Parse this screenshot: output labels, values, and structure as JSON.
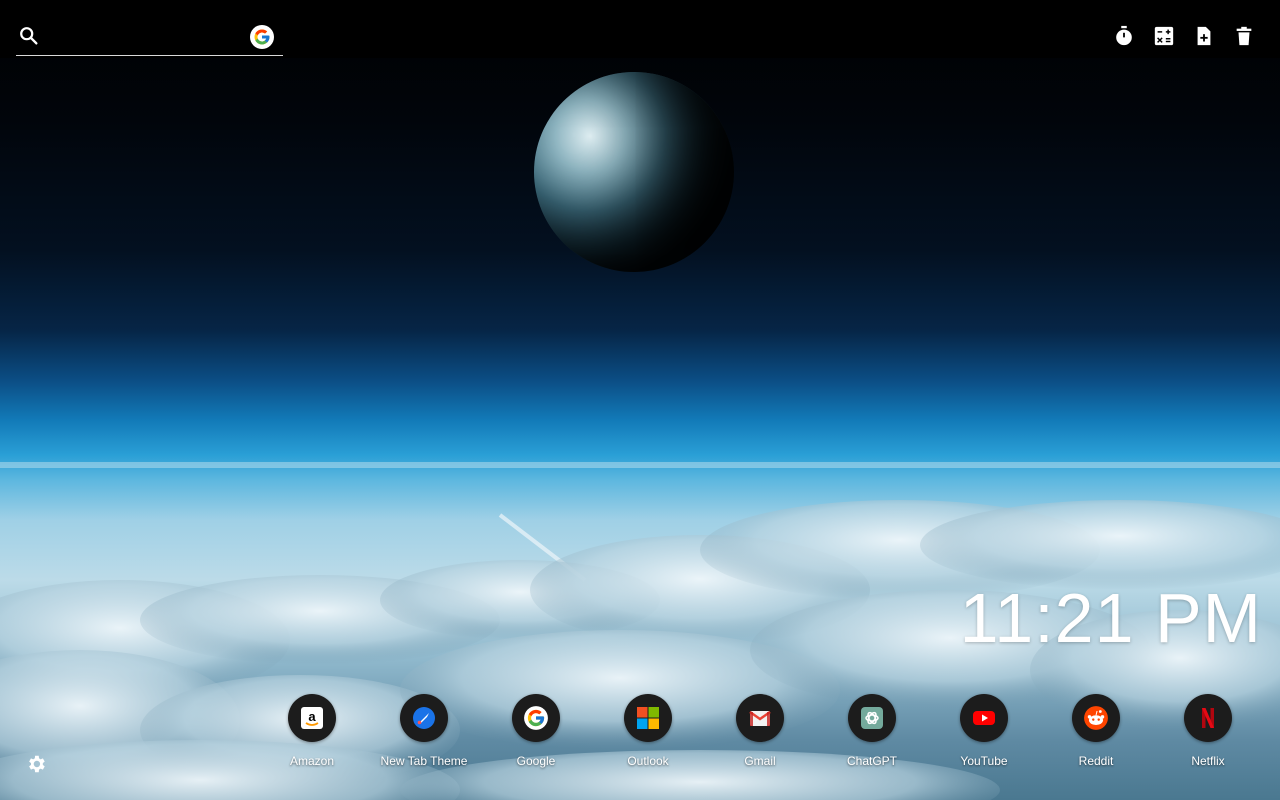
{
  "search": {
    "value": "",
    "placeholder": "",
    "engine_icon": "google-icon",
    "icon": "search-icon"
  },
  "toolbar": {
    "buttons": [
      {
        "name": "timer-button",
        "icon": "stopwatch-icon"
      },
      {
        "name": "calculator-button",
        "icon": "calculator-icon"
      },
      {
        "name": "new-note-button",
        "icon": "note-add-icon"
      },
      {
        "name": "delete-button",
        "icon": "trash-icon"
      }
    ]
  },
  "clock": {
    "time": "11:21 PM"
  },
  "shortcuts": [
    {
      "label": "Amazon",
      "icon": "amazon-icon"
    },
    {
      "label": "New Tab Theme",
      "icon": "new-tab-theme-icon"
    },
    {
      "label": "Google",
      "icon": "google-icon"
    },
    {
      "label": "Outlook",
      "icon": "microsoft-icon"
    },
    {
      "label": "Gmail",
      "icon": "gmail-icon"
    },
    {
      "label": "ChatGPT",
      "icon": "chatgpt-icon"
    },
    {
      "label": "YouTube",
      "icon": "youtube-icon"
    },
    {
      "label": "Reddit",
      "icon": "reddit-icon"
    },
    {
      "label": "Netflix",
      "icon": "netflix-icon"
    }
  ],
  "settings": {
    "icon": "gear-icon"
  },
  "colors": {
    "topbar": "#000000",
    "text": "#ffffff",
    "shortcut_circle": "#1c1c1c"
  }
}
